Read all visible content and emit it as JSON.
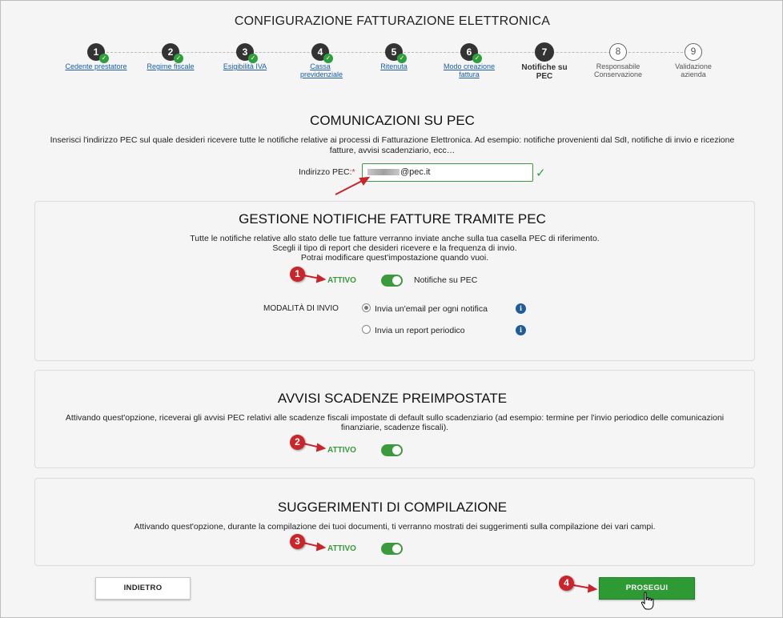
{
  "header": {
    "title": "CONFIGURAZIONE FATTURAZIONE ELETTRONICA"
  },
  "stepper": {
    "steps": [
      {
        "num": "1",
        "label": "Cedente prestatore",
        "state": "done"
      },
      {
        "num": "2",
        "label": "Regime fiscale",
        "state": "done"
      },
      {
        "num": "3",
        "label": "Esigibilità IVA",
        "state": "done"
      },
      {
        "num": "4",
        "label": "Cassa previdenziale",
        "state": "done"
      },
      {
        "num": "5",
        "label": "Ritenuta",
        "state": "done"
      },
      {
        "num": "6",
        "label": "Modo creazione fattura",
        "state": "done"
      },
      {
        "num": "7",
        "label": "Notifiche su PEC",
        "state": "current"
      },
      {
        "num": "8",
        "label": "Responsabile Conservazione",
        "state": "todo"
      },
      {
        "num": "9",
        "label": "Validazione azienda",
        "state": "todo"
      }
    ],
    "check_glyph": "✓"
  },
  "pec": {
    "title": "COMUNICAZIONI SU PEC",
    "description": "Inserisci l'indirizzo PEC sul quale desideri ricevere tutte le notifiche relative ai processi di Fatturazione Elettronica. Ad esempio: notifiche provenienti dal SdI, notifiche di invio e ricezione fatture, avvisi scadenziario, ecc…",
    "field_label": "Indirizzo PEC:",
    "required_mark": "*",
    "field_value_suffix": "@pec.it",
    "valid_glyph": "✓"
  },
  "gestione": {
    "title": "GESTIONE NOTIFICHE FATTURE TRAMITE PEC",
    "line1": "Tutte le notifiche relative allo stato delle tue fatture verranno inviate anche sulla tua casella PEC di riferimento.",
    "line2": "Scegli il tipo di report che desideri ricevere e la frequenza di invio.",
    "line3": "Potrai modificare quest'impostazione quando vuoi.",
    "status": "ATTIVO",
    "toggle_label": "Notifiche su PEC",
    "toggle_on": true,
    "mode_label": "MODALITÀ DI INVIO",
    "options": [
      {
        "label": "Invia un'email per ogni notifica",
        "selected": true
      },
      {
        "label": "Invia un report periodico",
        "selected": false
      }
    ],
    "info_glyph": "i"
  },
  "avvisi": {
    "title": "AVVISI SCADENZE PREIMPOSTATE",
    "line1": "Attivando quest'opzione, riceverai gli avvisi PEC relativi alle scadenze fiscali impostate di default sullo scadenziario (ad esempio: termine per l'invio periodico delle comunicazioni",
    "line2": "finanziarie, scadenze fiscali).",
    "status": "ATTIVO",
    "toggle_on": true
  },
  "suggerimenti": {
    "title": "SUGGERIMENTI DI COMPILAZIONE",
    "line1": "Attivando quest'opzione, durante la compilazione dei tuoi documenti, ti verranno mostrati dei suggerimenti sulla compilazione dei vari campi.",
    "status": "ATTIVO",
    "toggle_on": true
  },
  "footer": {
    "back_label": "INDIETRO",
    "next_label": "PROSEGUI"
  },
  "annotations": [
    "1",
    "2",
    "3",
    "4"
  ],
  "colors": {
    "accent_green": "#2e9a34",
    "annotation_red": "#c9252b",
    "link_blue": "#1b5eab",
    "info_blue": "#1f5d9a"
  }
}
